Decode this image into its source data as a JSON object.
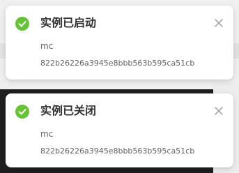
{
  "notifications": [
    {
      "title": "实例已启动",
      "name": "mc",
      "id": "822b26226a3945e8bbb563b595ca51cb",
      "status": "success",
      "icon": "check-circle-icon",
      "color": "#67c23a"
    },
    {
      "title": "实例已关闭",
      "name": "mc",
      "id": "822b26226a3945e8bbb563b595ca51cb",
      "status": "success",
      "icon": "check-circle-icon",
      "color": "#67c23a"
    }
  ]
}
